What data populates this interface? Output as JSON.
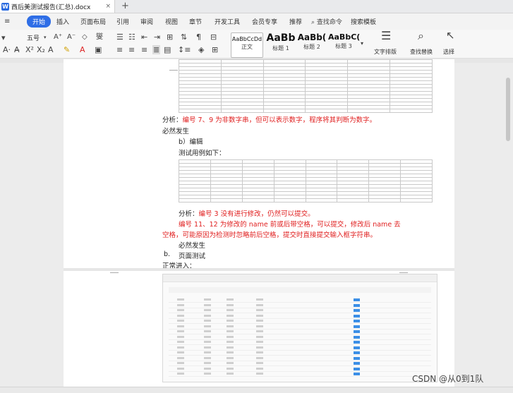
{
  "window": {
    "doc_tab_title": "西后美测试报告(汇总).docx",
    "tab_close": "×",
    "new_tab": "+"
  },
  "menu": {
    "items": [
      "开始",
      "插入",
      "页面布局",
      "引用",
      "审阅",
      "视图",
      "章节",
      "开发工具",
      "会员专享",
      "推荐"
    ],
    "active": "开始",
    "search_command": "查找命令",
    "search_template": "搜索模板"
  },
  "ribbon": {
    "font_size": "五号",
    "styles": [
      {
        "sample": "AaBbCcDd",
        "name": "正文"
      },
      {
        "sample": "AaBb",
        "name": "标题 1"
      },
      {
        "sample": "AaBb(",
        "name": "标题 2"
      },
      {
        "sample": "AaBbC(",
        "name": "标题 3"
      }
    ],
    "text_layout": "文字排版",
    "find_replace": "查找替换",
    "select": "选择"
  },
  "document": {
    "analysis1_label": "分析：",
    "analysis1_text": "编号 7、9 为非数字串，但可以表示数字，程序将其判断为数字。",
    "must_occur1": "必然发生",
    "b_edit": "b）编辑",
    "test_cases_intro": "测试用例如下：",
    "analysis2_label": "分析：",
    "analysis2_text": "编号 3 没有进行修改，仍然可以提交。",
    "analysis3_line1": "编号 11、12 为修改的 name 前或后带空格，可以提交，修改后 name 去",
    "analysis3_line2": "空格，可能原因为检测时忽略前后空格，提交时直接提交输入框字符串。",
    "must_occur2": "必然发生",
    "section_b": "b.",
    "section_title": "页面测试",
    "normal_entry": "正常进入："
  },
  "watermark": "CSDN @从0到1队",
  "colors": {
    "accent": "#2f6ee6",
    "highlight_red": "#e02020",
    "mini_button": "#3c8fe6"
  }
}
